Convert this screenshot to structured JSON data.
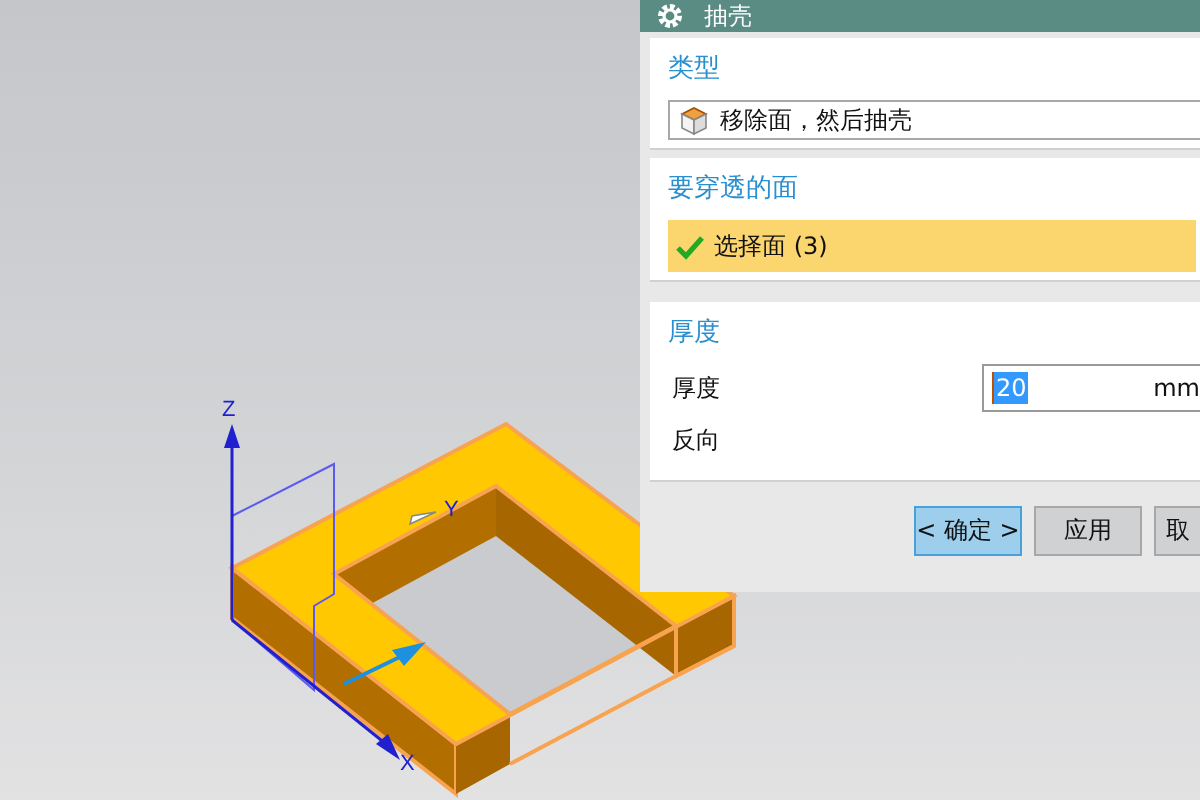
{
  "window": {
    "title": "抽壳"
  },
  "axes": [
    {
      "kind": "z",
      "label": "Z"
    },
    {
      "kind": "y",
      "label": "Y"
    },
    {
      "kind": "x",
      "label": "X"
    }
  ],
  "type_section": {
    "heading": "类型",
    "dropdown": {
      "value": "移除面，然后抽壳"
    }
  },
  "faces_section": {
    "heading": "要穿透的面",
    "selector": {
      "label": "选择面 (3)",
      "selected": true,
      "checked": true
    }
  },
  "thickness_section": {
    "heading": "厚度",
    "rows": [
      {
        "kind": "field",
        "label": "厚度",
        "value": "20",
        "unit": "mm",
        "text_selected": true
      },
      {
        "kind": "toggle",
        "label": "反向"
      }
    ]
  },
  "buttons": [
    {
      "label": "< 确定 >",
      "selected": true
    },
    {
      "label": "应用",
      "selected": false
    },
    {
      "label": "取",
      "selected": false
    }
  ]
}
